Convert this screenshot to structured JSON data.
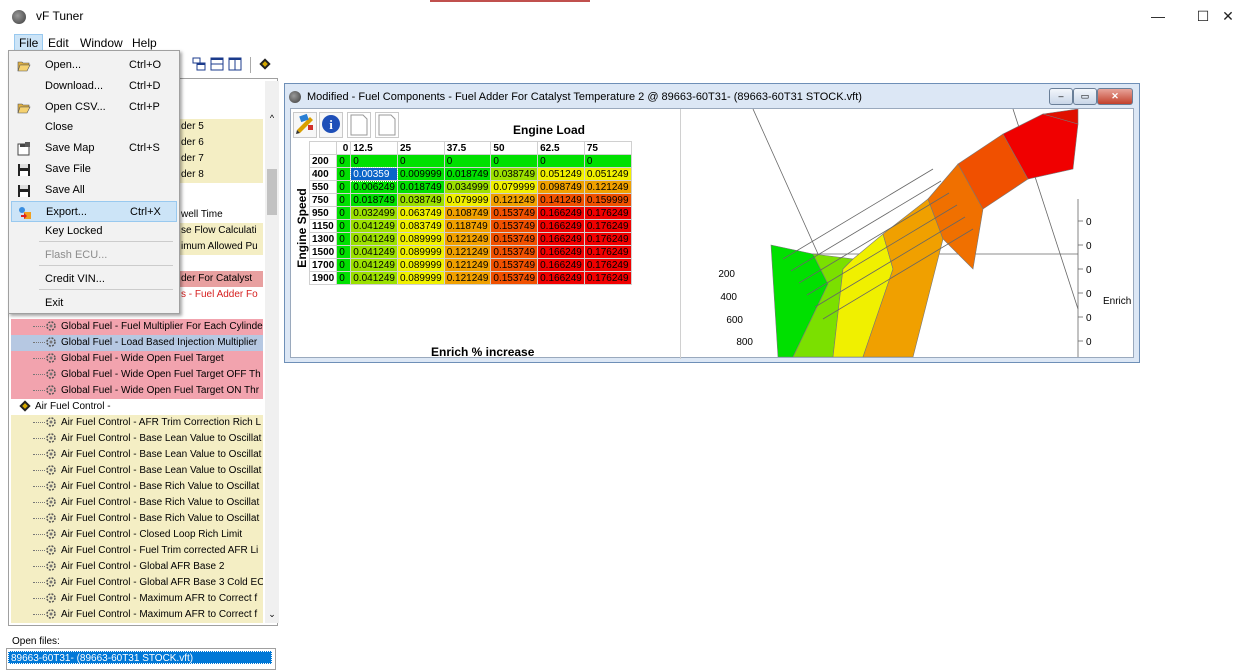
{
  "app": {
    "title": "vF Tuner"
  },
  "window_controls": {
    "minimize": "—",
    "maximize": "☐",
    "close": "✕"
  },
  "menubar": [
    "File",
    "Edit",
    "Window",
    "Help"
  ],
  "file_menu": [
    {
      "label": "Open...",
      "shortcut": "Ctrl+O",
      "icon": "folder-open-icon",
      "disabled": false
    },
    {
      "label": "Download...",
      "shortcut": "Ctrl+D",
      "icon": "",
      "disabled": false
    },
    {
      "label": "Open CSV...",
      "shortcut": "Ctrl+P",
      "icon": "folder-open-icon",
      "disabled": false
    },
    {
      "label": "Close",
      "shortcut": "",
      "icon": "",
      "disabled": false
    },
    {
      "label": "Save Map",
      "shortcut": "Ctrl+S",
      "icon": "save-map-icon",
      "disabled": false
    },
    {
      "label": "Save File",
      "shortcut": "",
      "icon": "floppy-icon",
      "disabled": false
    },
    {
      "label": "Save All",
      "shortcut": "",
      "icon": "floppy-icon",
      "disabled": false
    },
    {
      "label": "Export...",
      "shortcut": "Ctrl+X",
      "icon": "export-icon",
      "disabled": false,
      "hover": true
    },
    {
      "label": "Key Locked",
      "shortcut": "",
      "icon": "",
      "disabled": false
    },
    {
      "label": "Flash ECU...",
      "shortcut": "",
      "icon": "",
      "disabled": true
    },
    {
      "label": "Credit VIN...",
      "shortcut": "",
      "icon": "",
      "disabled": false
    },
    {
      "label": "Exit",
      "shortcut": "",
      "icon": "",
      "disabled": false
    }
  ],
  "tree_partial": [
    {
      "text": "der 5"
    },
    {
      "text": "der 6"
    },
    {
      "text": "der 7"
    },
    {
      "text": "der 8"
    },
    {
      "text": "well Time"
    },
    {
      "text": "se Flow Calculati"
    },
    {
      "text": "imum Allowed Pu"
    },
    {
      "text": "der For Catalyst"
    },
    {
      "text": "s - Fuel Adder Fo"
    }
  ],
  "tree": [
    {
      "label": "Global Fuel - Fuel Multiplier For Each Cylinde",
      "color": "pink"
    },
    {
      "label": "Global Fuel - Load Based Injection Multiplier",
      "color": "blue"
    },
    {
      "label": "Global Fuel - Wide Open Fuel Target",
      "color": "pink"
    },
    {
      "label": "Global Fuel - Wide Open Fuel Target OFF Th",
      "color": "pink"
    },
    {
      "label": "Global Fuel - Wide Open Fuel Target ON Thr",
      "color": "pink"
    },
    {
      "label": "Air Fuel Control -",
      "color": "none",
      "category": true
    },
    {
      "label": "Air Fuel Control - AFR Trim Correction Rich L",
      "color": "yellow"
    },
    {
      "label": "Air Fuel Control - Base Lean Value to Oscillat",
      "color": "yellow"
    },
    {
      "label": "Air Fuel Control - Base Lean Value to Oscillat",
      "color": "yellow"
    },
    {
      "label": "Air Fuel Control - Base Lean Value to Oscillat",
      "color": "yellow"
    },
    {
      "label": "Air Fuel Control - Base Rich Value to Oscillat",
      "color": "yellow"
    },
    {
      "label": "Air Fuel Control - Base Rich Value to Oscillat",
      "color": "yellow"
    },
    {
      "label": "Air Fuel Control - Base Rich Value to Oscillat",
      "color": "yellow"
    },
    {
      "label": "Air Fuel Control - Closed Loop Rich Limit",
      "color": "yellow"
    },
    {
      "label": "Air Fuel Control - Fuel Trim corrected AFR Li",
      "color": "yellow"
    },
    {
      "label": "Air Fuel Control - Global AFR Base 2",
      "color": "yellow"
    },
    {
      "label": "Air Fuel Control - Global AFR Base 3 Cold EC",
      "color": "yellow"
    },
    {
      "label": "Air Fuel Control - Maximum AFR to Correct f",
      "color": "yellow"
    },
    {
      "label": "Air Fuel Control - Maximum AFR to Correct f",
      "color": "yellow"
    }
  ],
  "open_files": {
    "label": "Open files:",
    "items": [
      "89663-60T31- (89663-60T31 STOCK.vft)"
    ]
  },
  "child_window": {
    "title": "Modified - Fuel Components - Fuel Adder For Catalyst Temperature 2 @ 89663-60T31- (89663-60T31 STOCK.vft)",
    "x_axis_label": "Engine Load",
    "y_axis_label": "Engine Speed",
    "value_label": "Enrich % increase",
    "columns": [
      "0",
      "12.5",
      "25",
      "37.5",
      "50",
      "62.5",
      "75"
    ],
    "rows": [
      {
        "rpm": "200",
        "values": [
          "0",
          "0",
          "0",
          "0",
          "0",
          "0",
          "0"
        ]
      },
      {
        "rpm": "400",
        "values": [
          "0",
          "0.00359",
          "0.009999",
          "0.018749",
          "0.038749",
          "0.051249",
          "0.051249"
        ]
      },
      {
        "rpm": "550",
        "values": [
          "0",
          "0.006249",
          "0.018749",
          "0.034999",
          "0.079999",
          "0.098749",
          "0.121249"
        ]
      },
      {
        "rpm": "750",
        "values": [
          "0",
          "0.018749",
          "0.038749",
          "0.079999",
          "0.121249",
          "0.141249",
          "0.159999"
        ]
      },
      {
        "rpm": "950",
        "values": [
          "0",
          "0.032499",
          "0.063749",
          "0.108749",
          "0.153749",
          "0.166249",
          "0.176249"
        ]
      },
      {
        "rpm": "1150",
        "values": [
          "0",
          "0.041249",
          "0.083749",
          "0.118749",
          "0.153749",
          "0.166249",
          "0.176249"
        ]
      },
      {
        "rpm": "1300",
        "values": [
          "0",
          "0.041249",
          "0.089999",
          "0.121249",
          "0.153749",
          "0.166249",
          "0.176249"
        ]
      },
      {
        "rpm": "1500",
        "values": [
          "0",
          "0.041249",
          "0.089999",
          "0.121249",
          "0.153749",
          "0.166249",
          "0.176249"
        ]
      },
      {
        "rpm": "1700",
        "values": [
          "0",
          "0.041249",
          "0.089999",
          "0.121249",
          "0.153749",
          "0.166249",
          "0.176249"
        ]
      },
      {
        "rpm": "1900",
        "values": [
          "0",
          "0.041249",
          "0.089999",
          "0.121249",
          "0.153749",
          "0.166249",
          "0.176249"
        ]
      }
    ],
    "selected_cell": {
      "row": 1,
      "col": 1
    },
    "chart": {
      "y_ticks": [
        "200",
        "400",
        "600",
        "800"
      ],
      "z_ticks": [
        "0",
        "0",
        "0",
        "0",
        "0",
        "0"
      ],
      "z_label": "Enrich"
    }
  },
  "colors": {
    "green": "#00e000",
    "yellowgreen": "#9be000",
    "yellow": "#f0f000",
    "orange": "#f0a000",
    "redorange": "#f05000",
    "red": "#f00000"
  }
}
